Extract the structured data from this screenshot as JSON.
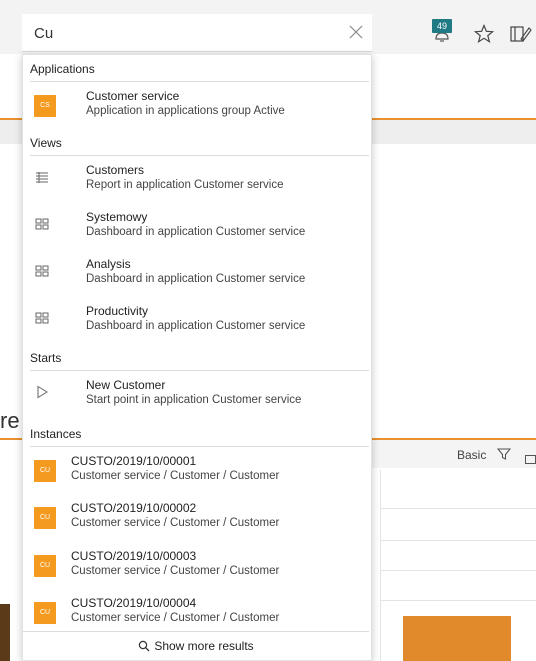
{
  "search": {
    "value": "Cu"
  },
  "notification": {
    "count": "49"
  },
  "background": {
    "partial_heading": "re",
    "view_mode": "Basic"
  },
  "sections": {
    "applications": {
      "title": "Applications",
      "items": [
        {
          "tile": "CS",
          "title": "Customer service",
          "subtitle": "Application in applications group Active"
        }
      ]
    },
    "views": {
      "title": "Views",
      "items": [
        {
          "icon": "report-list-icon",
          "title": "Customers",
          "subtitle": "Report in application Customer service"
        },
        {
          "icon": "dashboard-icon",
          "title": "Systemowy",
          "subtitle": "Dashboard in application Customer service"
        },
        {
          "icon": "dashboard-icon",
          "title": "Analysis",
          "subtitle": "Dashboard in application Customer service"
        },
        {
          "icon": "dashboard-icon",
          "title": "Productivity",
          "subtitle": "Dashboard in application Customer service"
        }
      ]
    },
    "starts": {
      "title": "Starts",
      "items": [
        {
          "icon": "play-icon",
          "title": "New Customer",
          "subtitle": "Start point in application Customer service"
        }
      ]
    },
    "instances": {
      "title": "Instances",
      "items": [
        {
          "tile": "CU",
          "title": "CUSTO/2019/10/00001",
          "subtitle": "Customer service / Customer / Customer"
        },
        {
          "tile": "CU",
          "title": "CUSTO/2019/10/00002",
          "subtitle": "Customer service / Customer / Customer"
        },
        {
          "tile": "CU",
          "title": "CUSTO/2019/10/00003",
          "subtitle": "Customer service / Customer / Customer"
        },
        {
          "tile": "CU",
          "title": "CUSTO/2019/10/00004",
          "subtitle": "Customer service / Customer / Customer"
        }
      ]
    }
  },
  "footer": {
    "label": "Show more results"
  },
  "colors": {
    "tile": "#f39a1f",
    "accent_line": "#e8912d",
    "badge": "#1f7a85"
  }
}
